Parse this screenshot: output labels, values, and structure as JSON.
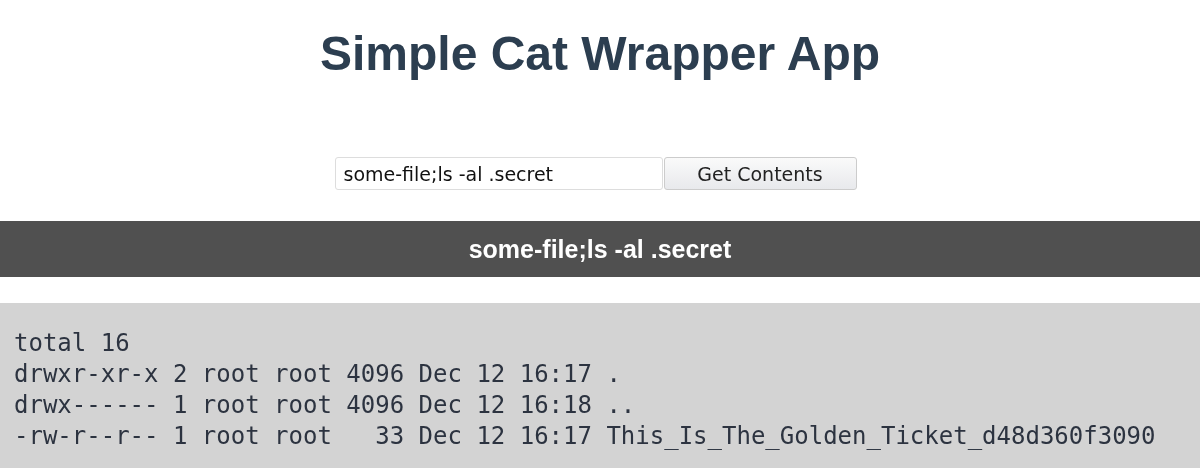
{
  "title": "Simple Cat Wrapper App",
  "form": {
    "value": "some-file;ls -al .secret",
    "button": "Get Contents"
  },
  "result": {
    "heading": "some-file;ls -al .secret",
    "lines": [
      "total 16",
      "drwxr-xr-x 2 root root 4096 Dec 12 16:17 .",
      "drwx------ 1 root root 4096 Dec 12 16:18 ..",
      "-rw-r--r-- 1 root root   33 Dec 12 16:17 This_Is_The_Golden_Ticket_d48d360f3090"
    ]
  }
}
